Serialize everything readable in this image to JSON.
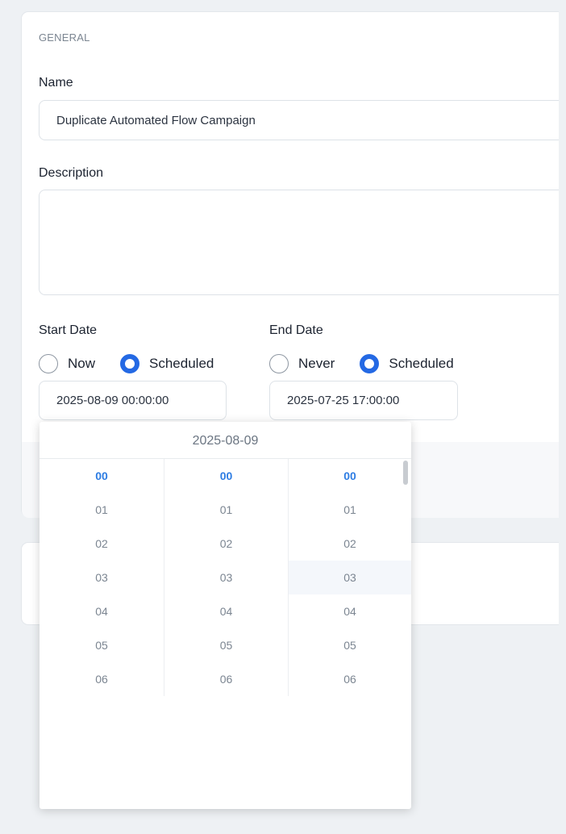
{
  "general": {
    "section_label": "GENERAL",
    "name_label": "Name",
    "name_value": "Duplicate Automated Flow Campaign",
    "description_label": "Description",
    "description_value": ""
  },
  "start_date": {
    "label": "Start Date",
    "options": [
      "Now",
      "Scheduled"
    ],
    "selected": "Scheduled",
    "value": "2025-08-09 00:00:00"
  },
  "end_date": {
    "label": "End Date",
    "options": [
      "Never",
      "Scheduled"
    ],
    "selected": "Scheduled",
    "value": "2025-07-25 17:00:00"
  },
  "time_picker": {
    "header": "2025-08-09",
    "hours": [
      "00",
      "01",
      "02",
      "03",
      "04",
      "05",
      "06"
    ],
    "minutes": [
      "00",
      "01",
      "02",
      "03",
      "04",
      "05",
      "06"
    ],
    "seconds": [
      "00",
      "01",
      "02",
      "03",
      "04",
      "05",
      "06"
    ],
    "selected_hour": "00",
    "selected_minute": "00",
    "selected_second": "00",
    "hovered_second": "03"
  },
  "colors": {
    "accent": "#2469e4",
    "selected_text": "#2e7de3",
    "background": "#eef1f4"
  }
}
